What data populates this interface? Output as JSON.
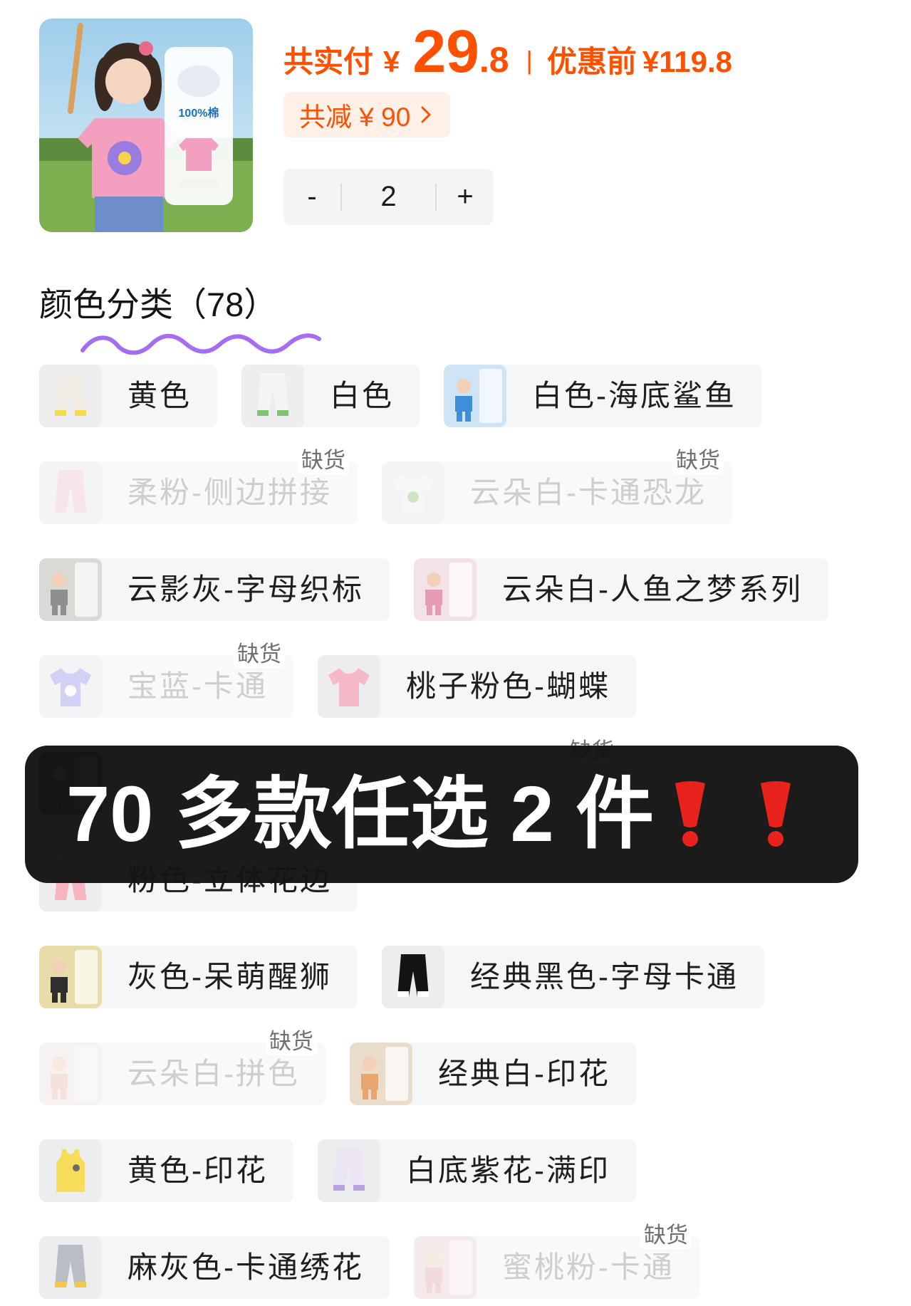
{
  "product": {
    "image_badge_text": "100%棉"
  },
  "price": {
    "paid_label": "共实付",
    "currency": "¥",
    "paid_int": "29",
    "paid_dec": ".8",
    "separator": "|",
    "original_label": "优惠前",
    "original_price": "¥119.8",
    "color": "#FF5000"
  },
  "discount": {
    "label": "共减 ¥ 90",
    "icon": "chevron-right-icon"
  },
  "quantity": {
    "minus": "-",
    "value": "2",
    "plus": "+"
  },
  "variants": {
    "title": "颜色分类（78）",
    "out_of_stock_label": "缺货",
    "rows": [
      [
        {
          "label": "黄色",
          "available": true,
          "thumb": {
            "kind": "pants",
            "color": "#F2ECE6",
            "accent": "#F2DC4A"
          }
        },
        {
          "label": "白色",
          "available": true,
          "thumb": {
            "kind": "pants",
            "color": "#F4F5F4",
            "accent": "#7FC46E"
          }
        },
        {
          "label": "白色-海底鲨鱼",
          "available": true,
          "thumb": {
            "kind": "photo",
            "color": "#CFE4F5",
            "accent": "#3F8FD8"
          }
        }
      ],
      [
        {
          "label": "柔粉-侧边拼接",
          "available": false,
          "thumb": {
            "kind": "pants",
            "color": "#F3C2CF",
            "accent": "#F3C2CF"
          }
        },
        {
          "label": "云朵白-卡通恐龙",
          "available": false,
          "thumb": {
            "kind": "tee",
            "color": "#F5F5F2",
            "accent": "#86C45E"
          }
        }
      ],
      [
        {
          "label": "云影灰-字母织标",
          "available": true,
          "thumb": {
            "kind": "photo",
            "color": "#D9D9D6",
            "accent": "#8E8E8E"
          }
        },
        {
          "label": "云朵白-人鱼之梦系列",
          "available": true,
          "thumb": {
            "kind": "photo",
            "color": "#F3E3E8",
            "accent": "#E59BB4"
          }
        }
      ],
      [
        {
          "label": "宝蓝-卡通",
          "available": false,
          "thumb": {
            "kind": "tee",
            "color": "#8A86EE",
            "accent": "#FFFFFF"
          }
        },
        {
          "label": "桃子粉色-蝴蝶",
          "available": true,
          "thumb": {
            "kind": "tee",
            "color": "#F6B9C8",
            "accent": "#F6B9C8"
          }
        }
      ],
      [
        {
          "label": "",
          "available": true,
          "thumb": {
            "kind": "photo",
            "color": "#3A3A3A",
            "accent": "#6C6C6C"
          }
        },
        {
          "label": "",
          "available": false,
          "thumb": {
            "kind": "pants",
            "color": "#DDE4EE",
            "accent": "#DDE4EE"
          }
        }
      ],
      [
        {
          "label": "粉色-立体花边",
          "available": true,
          "thumb": {
            "kind": "pants",
            "color": "#F5B4C0",
            "accent": "#F5B4C0"
          }
        }
      ],
      [
        {
          "label": "灰色-呆萌醒狮",
          "available": true,
          "thumb": {
            "kind": "photo",
            "color": "#E8DCA8",
            "accent": "#2F2F2F"
          }
        },
        {
          "label": "经典黑色-字母卡通",
          "available": true,
          "thumb": {
            "kind": "pants",
            "color": "#141414",
            "accent": "#FFFFFF"
          }
        }
      ],
      [
        {
          "label": "云朵白-拼色",
          "available": false,
          "thumb": {
            "kind": "photo",
            "color": "#F2E7E2",
            "accent": "#F0B9A6"
          }
        },
        {
          "label": "经典白-印花",
          "available": true,
          "thumb": {
            "kind": "photo",
            "color": "#EADCCB",
            "accent": "#E8A66E"
          }
        }
      ],
      [
        {
          "label": "黄色-印花",
          "available": true,
          "thumb": {
            "kind": "tank",
            "color": "#F6DE5C",
            "accent": "#F6DE5C"
          }
        },
        {
          "label": "白底紫花-满印",
          "available": true,
          "thumb": {
            "kind": "pants",
            "color": "#ECE6F4",
            "accent": "#B7A2DE"
          }
        }
      ],
      [
        {
          "label": "麻灰色-卡通绣花",
          "available": true,
          "thumb": {
            "kind": "pants",
            "color": "#B9BDC6",
            "accent": "#F2C94C"
          }
        },
        {
          "label": "蜜桃粉-卡通",
          "available": false,
          "thumb": {
            "kind": "photo",
            "color": "#F3D4D2",
            "accent": "#E9A1A0"
          }
        }
      ]
    ]
  },
  "promo_overlay": {
    "text": "70 多款任选 2 件",
    "icons": [
      "exclamation-icon",
      "exclamation-icon"
    ],
    "icon_color": "#E8231E"
  }
}
